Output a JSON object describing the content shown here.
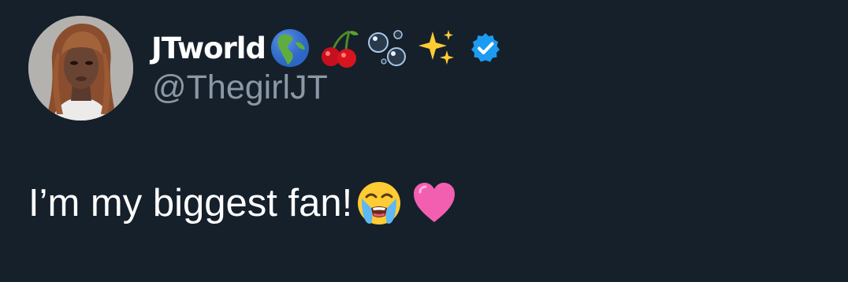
{
  "tweet": {
    "author": {
      "display_name": "JTworld",
      "handle": "@ThegirlJT",
      "verified": true,
      "name_emojis": [
        "globe-americas-icon",
        "cherries-icon",
        "bubbles-icon",
        "sparkles-icon"
      ]
    },
    "text": "I’m my biggest fan!",
    "text_emojis": [
      "loudly-crying-face-icon",
      "pink-heart-icon"
    ]
  },
  "colors": {
    "background": "#15202b",
    "text_primary": "#ffffff",
    "text_secondary": "#8b98a5",
    "verified_badge": "#1d9bf0",
    "heart": "#f25fb0"
  }
}
